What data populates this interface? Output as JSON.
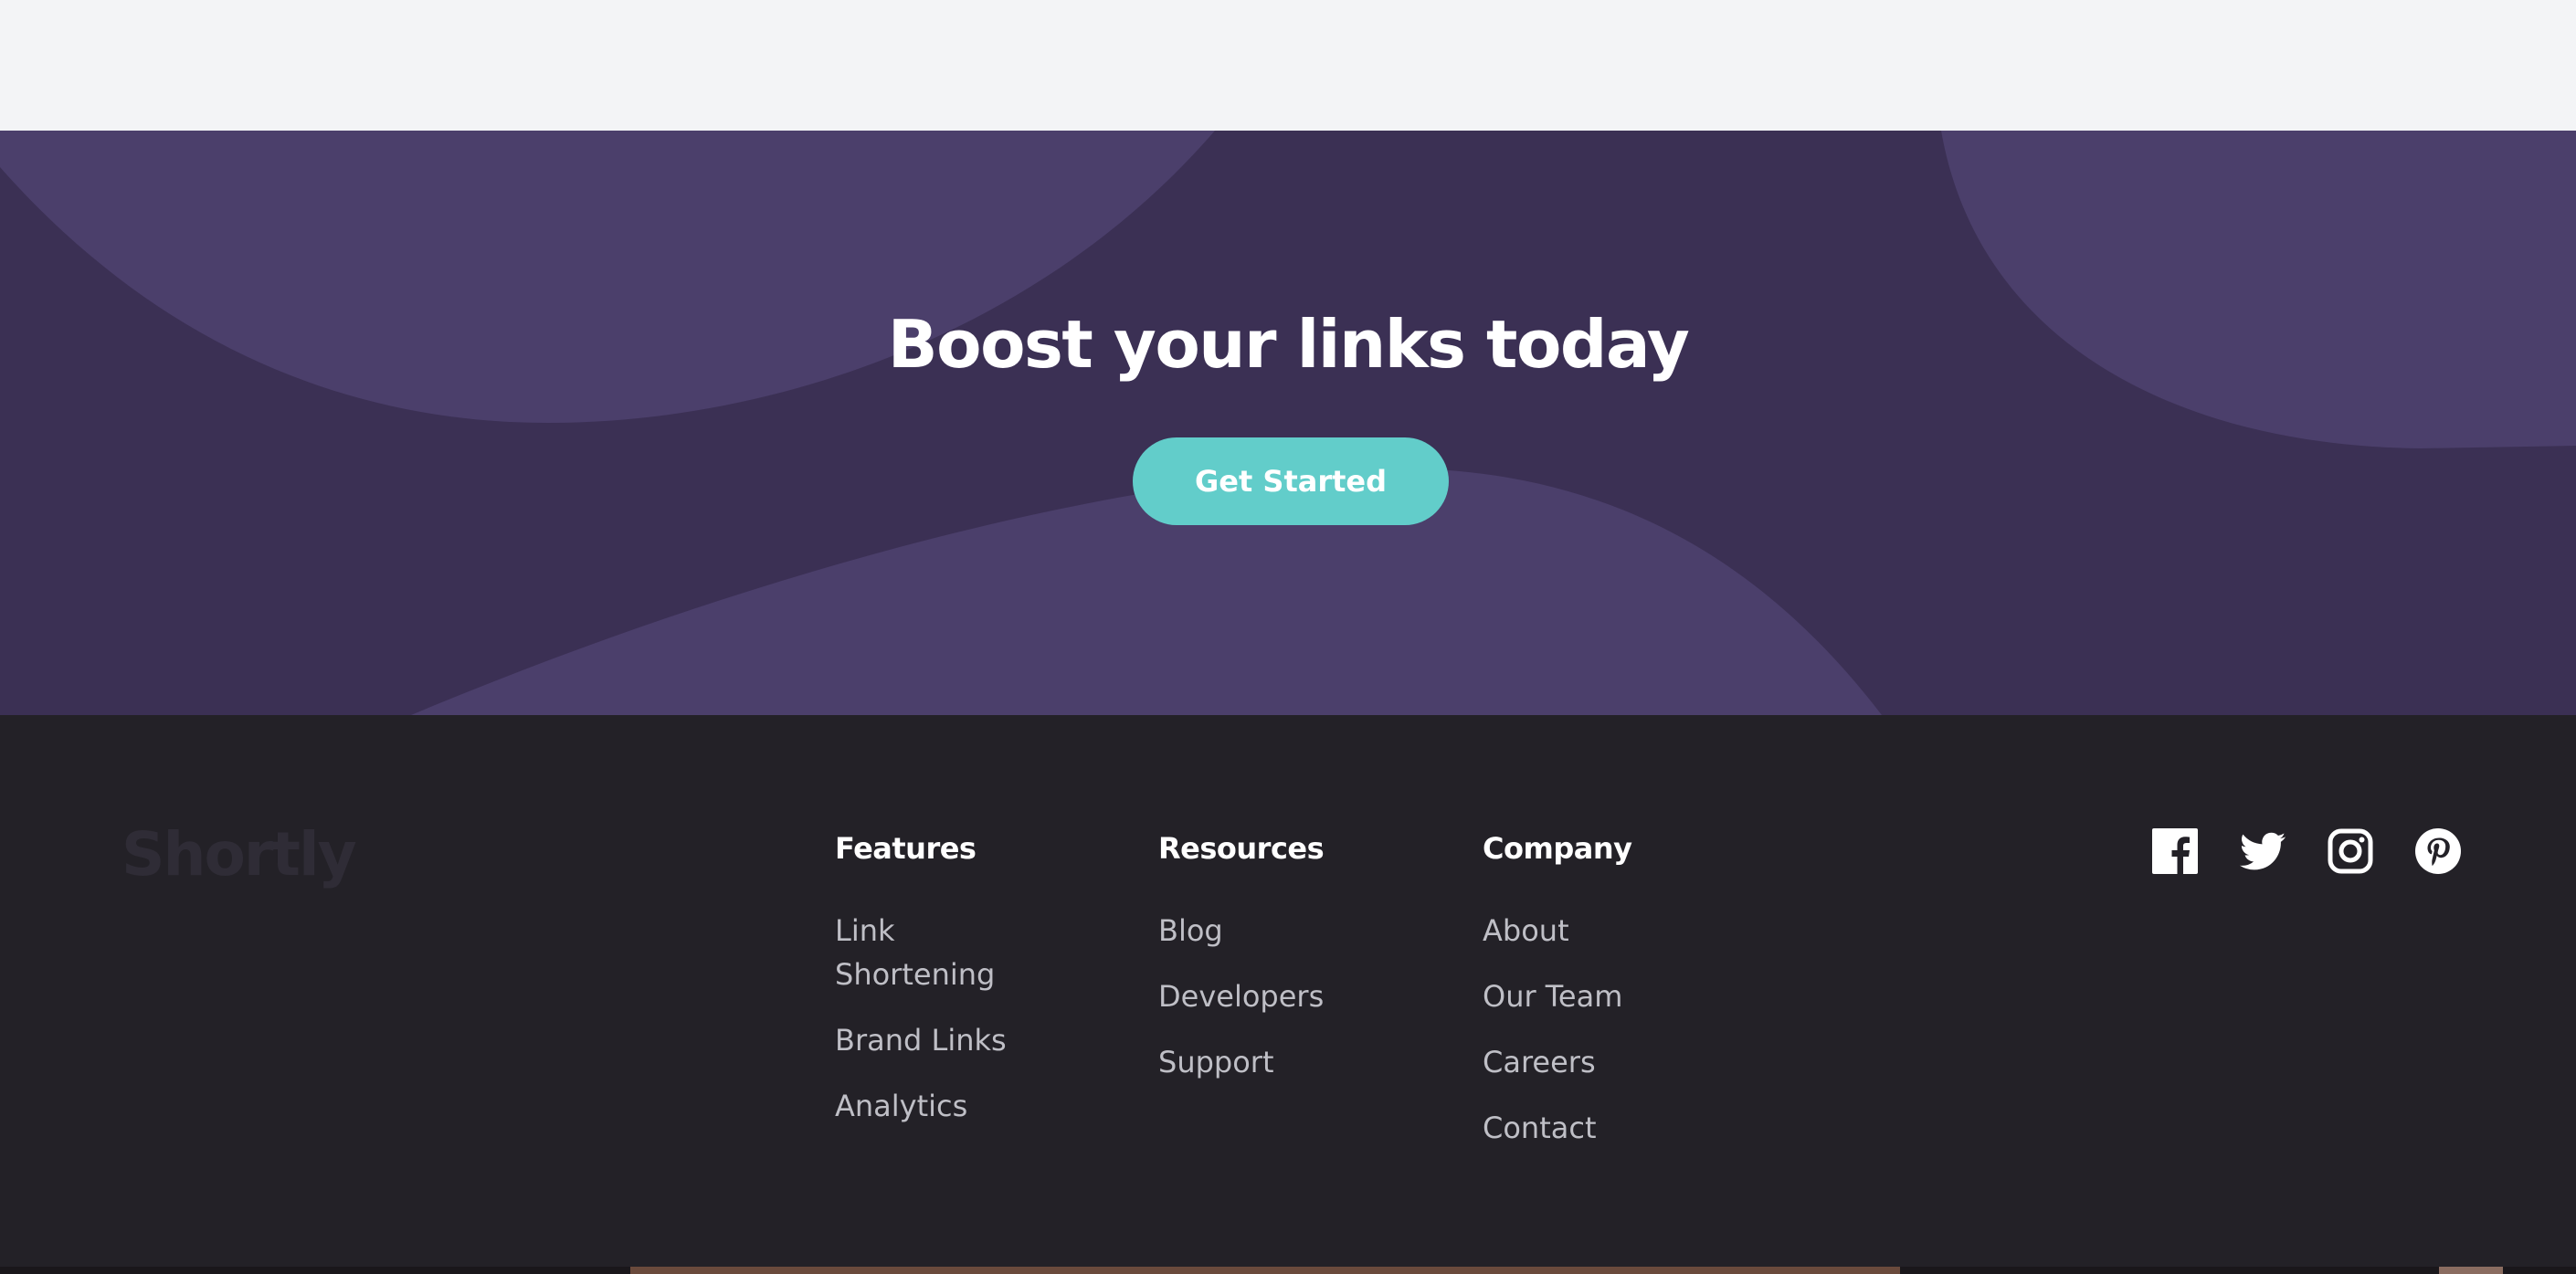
{
  "boost": {
    "title": "Boost your links today",
    "cta_label": "Get Started"
  },
  "footer": {
    "logo": "Shortly",
    "columns": [
      {
        "heading": "Features",
        "links": [
          "Link Shortening",
          "Brand Links",
          "Analytics"
        ]
      },
      {
        "heading": "Resources",
        "links": [
          "Blog",
          "Developers",
          "Support"
        ]
      },
      {
        "heading": "Company",
        "links": [
          "About",
          "Our Team",
          "Careers",
          "Contact"
        ]
      }
    ],
    "social": [
      "facebook-icon",
      "twitter-icon",
      "instagram-icon",
      "pinterest-icon"
    ]
  },
  "colors": {
    "boost_bg": "#3b3054",
    "boost_shape": "#4b3f6b",
    "cta": "#62cdca",
    "footer_bg": "#232127",
    "link": "#bfbfc6",
    "heading": "#ffffff"
  }
}
